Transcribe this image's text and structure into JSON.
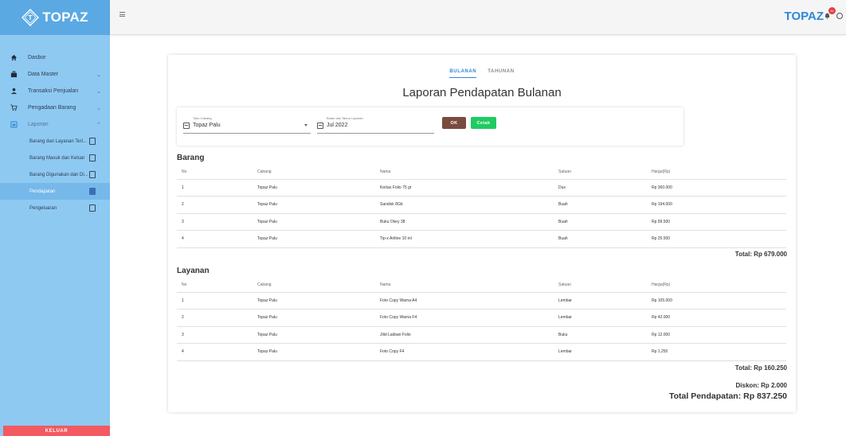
{
  "app": {
    "brand": "TOPAZ",
    "brand_logo_letter": "T",
    "notification_count": "32"
  },
  "sidebar": {
    "menu": [
      {
        "label": "Dasbor",
        "icon": "home-icon"
      },
      {
        "label": "Data Master",
        "icon": "briefcase-icon",
        "expandable": true
      },
      {
        "label": "Transaksi Penjualan",
        "icon": "person-icon",
        "expandable": true
      },
      {
        "label": "Pengadaan Barang",
        "icon": "cart-icon",
        "expandable": true
      },
      {
        "label": "Laporan",
        "icon": "report-icon",
        "expanded": true
      }
    ],
    "sub_items": [
      {
        "label": "Barang dan Layanan Terl..."
      },
      {
        "label": "Barang Masuk dan Keluar"
      },
      {
        "label": "Barang Digunakan dan Di..."
      },
      {
        "label": "Pendapatan",
        "selected": true
      },
      {
        "label": "Pengeluaran"
      }
    ],
    "logout_label": "KELUAR"
  },
  "tabs": [
    {
      "label": "BULANAN",
      "active": true
    },
    {
      "label": "TAHUNAN",
      "active": false
    }
  ],
  "report_title": "Laporan Pendapatan Bulanan",
  "filters": {
    "branch_label": "Toko Cabang",
    "branch_value": "Topaz Palu",
    "period_label": "Bulan dan Tahun Laporan",
    "period_value": "Jul 2022",
    "ok_label": "OK",
    "print_label": "Cetak"
  },
  "columns": {
    "no": "No",
    "cabang": "Cabang",
    "nama": "Nama",
    "satuan": "Satuan",
    "harga": "Harga(Rp)"
  },
  "barang": {
    "title": "Barang",
    "rows": [
      {
        "no": "1",
        "cabang": "Topaz Palu",
        "nama": "Kertas Folio 75 gr",
        "satuan": "Dus",
        "harga": "Rp 360.000"
      },
      {
        "no": "2",
        "cabang": "Topaz Palu",
        "nama": "Sandisk 8Gb",
        "satuan": "Buah",
        "harga": "Rp 194.000"
      },
      {
        "no": "3",
        "cabang": "Topaz Palu",
        "nama": "Buku Okey 38",
        "satuan": "Buah",
        "harga": "Rp 99.500"
      },
      {
        "no": "4",
        "cabang": "Topaz Palu",
        "nama": "Tip-x Artline 10 ml",
        "satuan": "Buah",
        "harga": "Rp 25.500"
      }
    ],
    "total": "Total: Rp 679.000"
  },
  "layanan": {
    "title": "Layanan",
    "rows": [
      {
        "no": "1",
        "cabang": "Topaz Palu",
        "nama": "Foto Copy Warna A4",
        "satuan": "Lembar",
        "harga": "Rp 105.000"
      },
      {
        "no": "2",
        "cabang": "Topaz Palu",
        "nama": "Foto Copy Warna F4",
        "satuan": "Lembar",
        "harga": "Rp 42.000"
      },
      {
        "no": "3",
        "cabang": "Topaz Palu",
        "nama": "Jilid Lakban Folio",
        "satuan": "Buku",
        "harga": "Rp 12.000"
      },
      {
        "no": "4",
        "cabang": "Topaz Palu",
        "nama": "Foto Copy F4",
        "satuan": "Lembar",
        "harga": "Rp 1.250"
      }
    ],
    "total": "Total: Rp 160.250"
  },
  "discount": "Diskon: Rp 2.000",
  "grand_total": "Total Pendapatan: Rp 837.250"
}
